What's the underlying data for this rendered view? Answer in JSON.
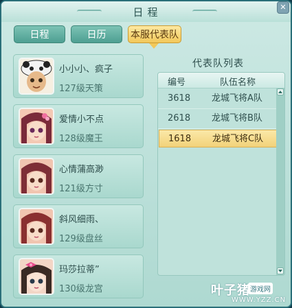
{
  "window": {
    "title": "日程",
    "close_glyph": "✕"
  },
  "tabs": [
    {
      "label": "日程",
      "active": false
    },
    {
      "label": "日历",
      "active": false
    },
    {
      "label": "本服代表队",
      "active": true
    }
  ],
  "players": [
    {
      "name": "小小小、疯子",
      "level": "127级天策",
      "avatar_icon": "boy-panda-hat-avatar"
    },
    {
      "name": "爱情小不点",
      "level": "128级魔王",
      "avatar_icon": "girl-flower-avatar"
    },
    {
      "name": "心情蒲高渺",
      "level": "121级方寸",
      "avatar_icon": "girl-avatar"
    },
    {
      "name": "斜风细雨、",
      "level": "129级盘丝",
      "avatar_icon": "girl-avatar"
    },
    {
      "name": "玛莎拉蒂”",
      "level": "130级龙宫",
      "avatar_icon": "girl-bow-avatar"
    }
  ],
  "team_list": {
    "title": "代表队列表",
    "columns": [
      "编号",
      "队伍名称"
    ],
    "rows": [
      {
        "id": "3618",
        "name": "龙城飞将A队",
        "selected": false
      },
      {
        "id": "2618",
        "name": "龙城飞将B队",
        "selected": false
      },
      {
        "id": "1618",
        "name": "龙城飞将C队",
        "selected": true
      }
    ]
  },
  "watermark": {
    "brand": "叶子猪",
    "badge": "游戏网",
    "url": "WWW.YZZ.CN"
  },
  "colors": {
    "panel_bg": "#aed9d1",
    "tab_active": "#f2c85a",
    "tab_inactive": "#4e9f92",
    "row_selected": "#f2d27a"
  }
}
